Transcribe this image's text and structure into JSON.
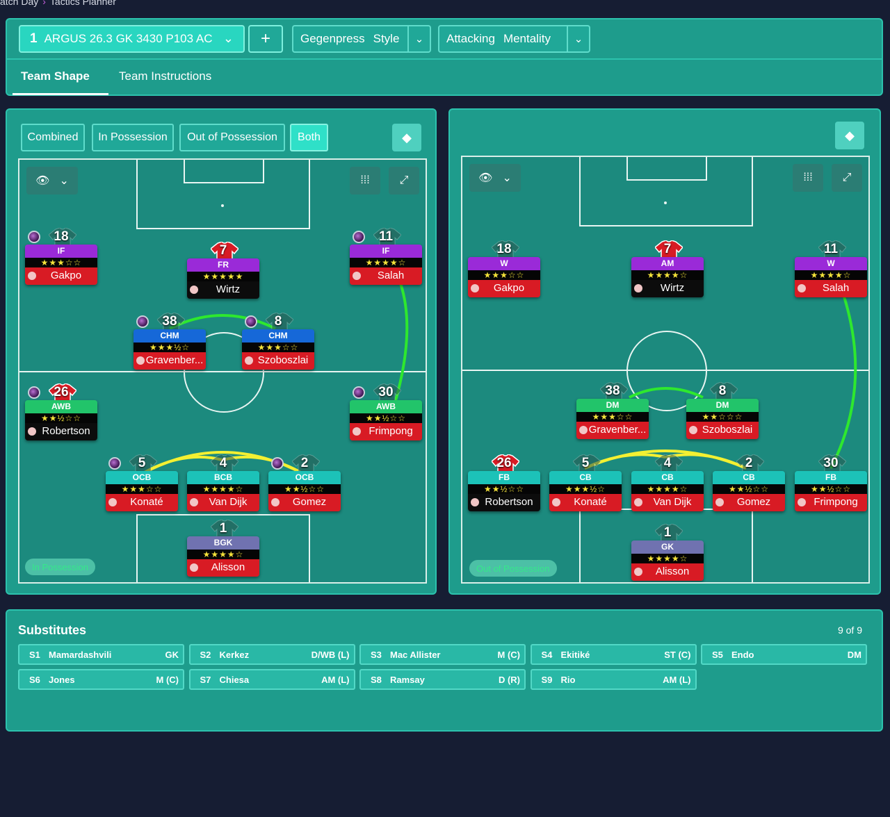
{
  "breadcrumb": {
    "part1": "atch Day",
    "part2": "Tactics Planner"
  },
  "tactic": {
    "number": "1",
    "name": "ARGUS 26.3 GK 3430 P103 AC",
    "add_label": "+",
    "style_value": "Gegenpress",
    "style_label": "Style",
    "mentality_value": "Attacking",
    "mentality_label": "Mentality"
  },
  "tabs": {
    "team_shape": "Team Shape",
    "team_instructions": "Team Instructions"
  },
  "view_toggles": {
    "combined": "Combined",
    "in_possession": "In Possession",
    "out_of_possession": "Out of Possession",
    "both": "Both"
  },
  "left_pitch": {
    "mode": "In Possession",
    "players": [
      {
        "id": "l-gakpo",
        "num": "18",
        "role": "IF",
        "stars": "★★★☆☆",
        "name": "Gakpo",
        "role_color": "purple",
        "name_color": "red",
        "ball": true,
        "shirt": false
      },
      {
        "id": "l-wirtz",
        "num": "7",
        "role": "FR",
        "stars": "★★★★★",
        "name": "Wirtz",
        "role_color": "purple",
        "name_color": "black",
        "ball": false,
        "shirt": true
      },
      {
        "id": "l-salah",
        "num": "11",
        "role": "IF",
        "stars": "★★★★☆",
        "name": "Salah",
        "role_color": "purple",
        "name_color": "red",
        "ball": true,
        "shirt": false
      },
      {
        "id": "l-grav",
        "num": "38",
        "role": "CHM",
        "stars": "★★★½☆",
        "name": "Gravenber...",
        "role_color": "blue",
        "name_color": "red",
        "ball": true,
        "shirt": false
      },
      {
        "id": "l-szob",
        "num": "8",
        "role": "CHM",
        "stars": "★★★☆☆",
        "name": "Szoboszlai",
        "role_color": "blue",
        "name_color": "red",
        "ball": true,
        "shirt": false
      },
      {
        "id": "l-rob",
        "num": "26",
        "role": "AWB",
        "stars": "★★½☆☆",
        "name": "Robertson",
        "role_color": "green",
        "name_color": "black",
        "ball": true,
        "shirt": true
      },
      {
        "id": "l-frim",
        "num": "30",
        "role": "AWB",
        "stars": "★★½☆☆",
        "name": "Frimpong",
        "role_color": "green",
        "name_color": "red",
        "ball": true,
        "shirt": false
      },
      {
        "id": "l-kon",
        "num": "5",
        "role": "OCB",
        "stars": "★★★☆☆",
        "name": "Konaté",
        "role_color": "teal",
        "name_color": "red",
        "ball": true,
        "shirt": false
      },
      {
        "id": "l-vvd",
        "num": "4",
        "role": "BCB",
        "stars": "★★★★☆",
        "name": "Van Dijk",
        "role_color": "teal",
        "name_color": "red",
        "ball": false,
        "shirt": false
      },
      {
        "id": "l-gom",
        "num": "2",
        "role": "OCB",
        "stars": "★★½☆☆",
        "name": "Gomez",
        "role_color": "teal",
        "name_color": "red",
        "ball": true,
        "shirt": false
      },
      {
        "id": "l-ali",
        "num": "1",
        "role": "BGK",
        "stars": "★★★★☆",
        "name": "Alisson",
        "role_color": "grey",
        "name_color": "red",
        "ball": false,
        "shirt": false
      }
    ]
  },
  "right_pitch": {
    "mode": "Out of Possession",
    "players": [
      {
        "id": "r-gakpo",
        "num": "18",
        "role": "W",
        "stars": "★★★☆☆",
        "name": "Gakpo",
        "role_color": "purple",
        "name_color": "red",
        "ball": false,
        "shirt": false
      },
      {
        "id": "r-wirtz",
        "num": "7",
        "role": "AM",
        "stars": "★★★★☆",
        "name": "Wirtz",
        "role_color": "purple",
        "name_color": "black",
        "ball": false,
        "shirt": true
      },
      {
        "id": "r-salah",
        "num": "11",
        "role": "W",
        "stars": "★★★★☆",
        "name": "Salah",
        "role_color": "purple",
        "name_color": "red",
        "ball": false,
        "shirt": false
      },
      {
        "id": "r-grav",
        "num": "38",
        "role": "DM",
        "stars": "★★★☆☆",
        "name": "Gravenber...",
        "role_color": "green",
        "name_color": "red",
        "ball": false,
        "shirt": false
      },
      {
        "id": "r-szob",
        "num": "8",
        "role": "DM",
        "stars": "★★☆☆☆",
        "name": "Szoboszlai",
        "role_color": "green",
        "name_color": "red",
        "ball": false,
        "shirt": false
      },
      {
        "id": "r-rob",
        "num": "26",
        "role": "FB",
        "stars": "★★½☆☆",
        "name": "Robertson",
        "role_color": "teal",
        "name_color": "black",
        "ball": false,
        "shirt": true
      },
      {
        "id": "r-kon",
        "num": "5",
        "role": "CB",
        "stars": "★★★½☆",
        "name": "Konaté",
        "role_color": "teal",
        "name_color": "red",
        "ball": false,
        "shirt": false
      },
      {
        "id": "r-vvd",
        "num": "4",
        "role": "CB",
        "stars": "★★★★☆",
        "name": "Van Dijk",
        "role_color": "teal",
        "name_color": "red",
        "ball": false,
        "shirt": false
      },
      {
        "id": "r-gom",
        "num": "2",
        "role": "CB",
        "stars": "★★½☆☆",
        "name": "Gomez",
        "role_color": "teal",
        "name_color": "red",
        "ball": false,
        "shirt": false
      },
      {
        "id": "r-frim",
        "num": "30",
        "role": "FB",
        "stars": "★★½☆☆",
        "name": "Frimpong",
        "role_color": "teal",
        "name_color": "red",
        "ball": false,
        "shirt": false
      },
      {
        "id": "r-ali",
        "num": "1",
        "role": "GK",
        "stars": "★★★★☆",
        "name": "Alisson",
        "role_color": "grey",
        "name_color": "red",
        "ball": false,
        "shirt": false
      }
    ]
  },
  "substitutes": {
    "title": "Substitutes",
    "count": "9 of 9",
    "items": [
      {
        "code": "S1",
        "name": "Mamardashvili",
        "pos": "GK"
      },
      {
        "code": "S2",
        "name": "Kerkez",
        "pos": "D/WB (L)"
      },
      {
        "code": "S3",
        "name": "Mac Allister",
        "pos": "M (C)"
      },
      {
        "code": "S4",
        "name": "Ekitiké",
        "pos": "ST (C)"
      },
      {
        "code": "S5",
        "name": "Endo",
        "pos": "DM"
      },
      {
        "code": "S6",
        "name": "Jones",
        "pos": "M (C)"
      },
      {
        "code": "S7",
        "name": "Chiesa",
        "pos": "AM (L)"
      },
      {
        "code": "S8",
        "name": "Ramsay",
        "pos": "D (R)"
      },
      {
        "code": "S9",
        "name": "Rio",
        "pos": "AM (L)"
      }
    ]
  },
  "colors": {
    "panel": "#1e9c8c",
    "accent": "#29d6c0",
    "link_green": "#2ee82e",
    "link_yellow": "#f3f032"
  }
}
